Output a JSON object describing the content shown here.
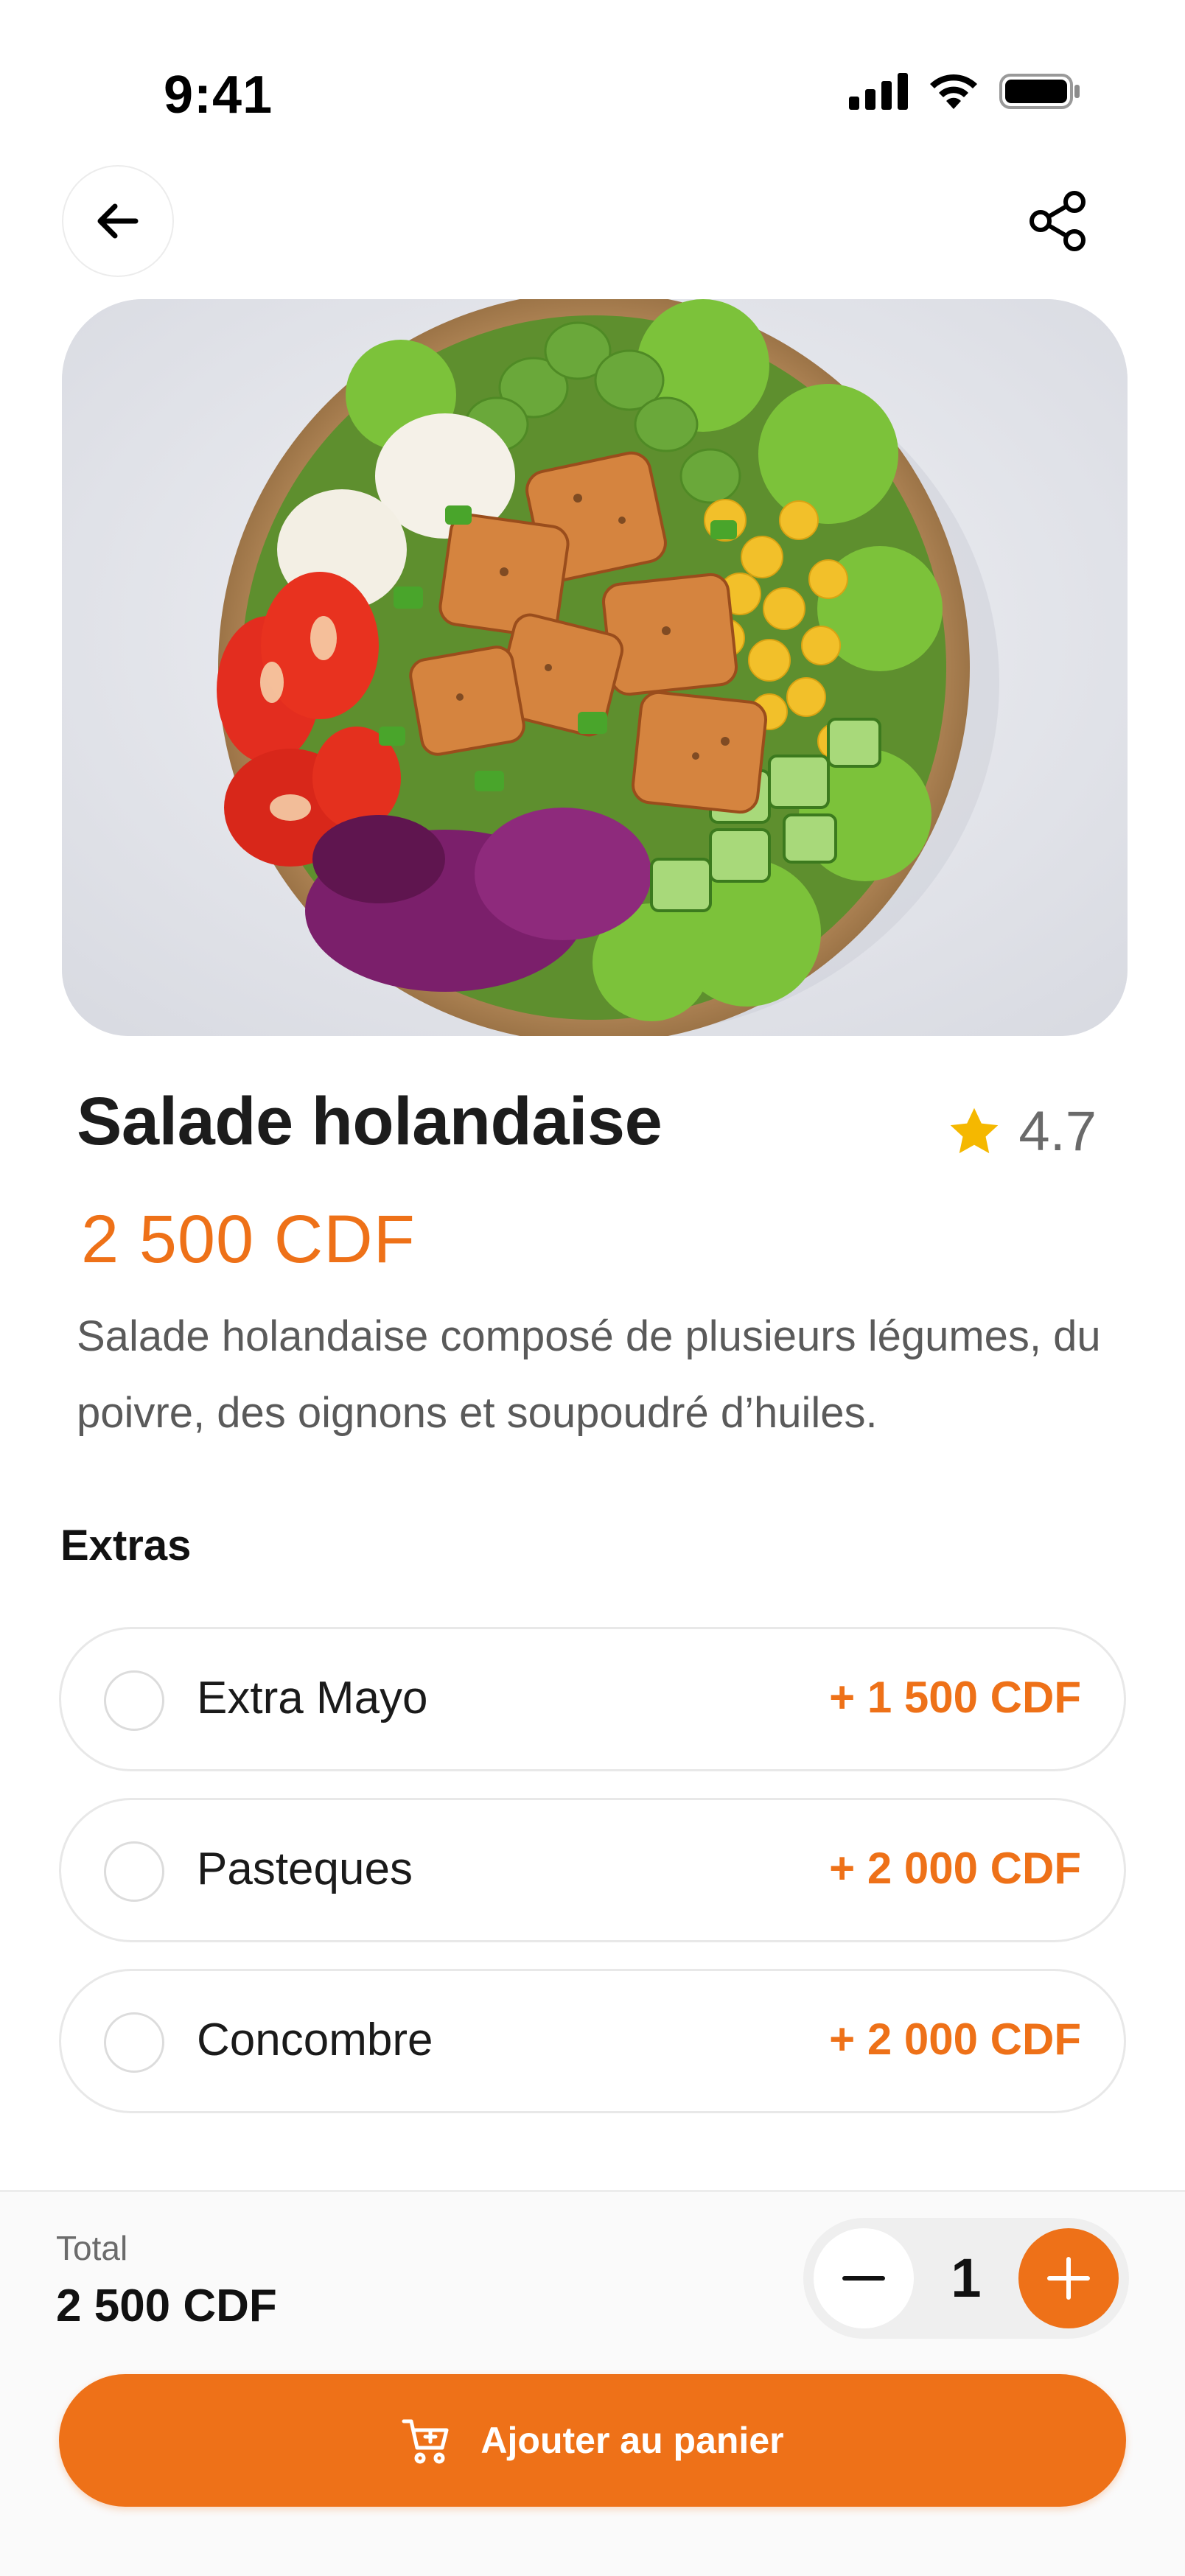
{
  "status": {
    "time": "9:41"
  },
  "product": {
    "title": "Salade holandaise",
    "rating": "4.7",
    "price": "2 500 CDF",
    "description": "Salade holandaise composé de plusieurs légumes, du poivre, des oignons et soupoudré d’huiles."
  },
  "extras": {
    "heading": "Extras",
    "items": [
      {
        "name": "Extra Mayo",
        "price": "+ 1 500 CDF"
      },
      {
        "name": "Pasteques",
        "price": "+ 2 000 CDF"
      },
      {
        "name": "Concombre",
        "price": "+ 2 000 CDF"
      }
    ]
  },
  "footer": {
    "total_label": "Total",
    "total_value": "2 500 CDF",
    "quantity": "1",
    "cta_label": "Ajouter au panier"
  },
  "colors": {
    "accent": "#ee7118",
    "star": "#f5b800"
  },
  "icons": [
    "back-arrow-icon",
    "share-icon",
    "star-icon",
    "minus-icon",
    "plus-icon",
    "cart-add-icon"
  ]
}
